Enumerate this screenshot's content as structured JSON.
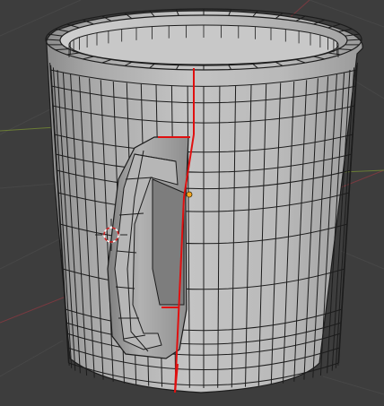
{
  "viewport": {
    "background": "#3d3d3d",
    "grid_color": "#474747",
    "axis_x_color": "#a13c44",
    "axis_y_color": "#7c9a2b"
  },
  "mesh": {
    "object": "mug",
    "face_color": "#b8b8b8",
    "wire_color": "#1c1c1c",
    "seam_color": "#e01010",
    "vertex_color": "#f5a623"
  },
  "icons": {
    "cursor": "3d-cursor-icon",
    "origin": "object-origin-icon"
  }
}
